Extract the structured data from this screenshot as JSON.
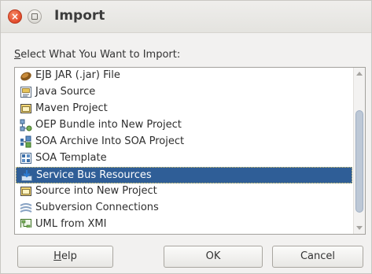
{
  "window": {
    "title": "Import",
    "close_glyph": "×"
  },
  "prompt": {
    "mnemonic": "S",
    "rest": "elect What You Want to Import:"
  },
  "list": {
    "items": [
      {
        "label": "EJB JAR (.jar) File",
        "icon": "ejb-jar-icon"
      },
      {
        "label": "Java Source",
        "icon": "java-source-icon"
      },
      {
        "label": "Maven Project",
        "icon": "maven-project-icon"
      },
      {
        "label": "OEP Bundle into New Project",
        "icon": "oep-bundle-icon"
      },
      {
        "label": "SOA Archive Into SOA Project",
        "icon": "soa-archive-icon"
      },
      {
        "label": "SOA Template",
        "icon": "soa-template-icon"
      },
      {
        "label": "Service Bus Resources",
        "icon": "service-bus-icon",
        "selected": true
      },
      {
        "label": "Source into New Project",
        "icon": "source-project-icon"
      },
      {
        "label": "Subversion Connections",
        "icon": "subversion-icon"
      },
      {
        "label": "UML from XMI",
        "icon": "uml-xmi-icon"
      }
    ]
  },
  "buttons": {
    "help_mnemonic": "H",
    "help_rest": "elp",
    "ok": "OK",
    "cancel": "Cancel"
  }
}
